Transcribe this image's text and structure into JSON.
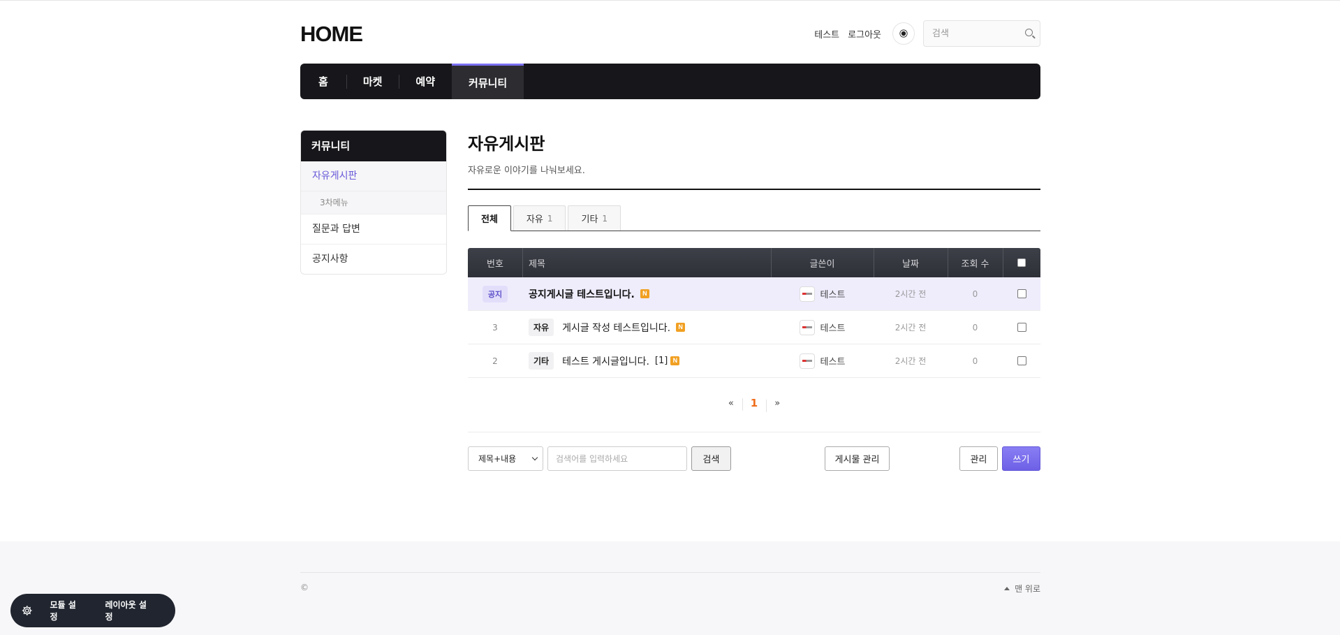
{
  "header": {
    "logo": "HOME",
    "user_name": "테스트",
    "logout": "로그아웃",
    "search_placeholder": "검색"
  },
  "nav": [
    "홈",
    "마켓",
    "예약",
    "커뮤니티"
  ],
  "sidebar": {
    "title": "커뮤니티",
    "items": [
      "자유게시판",
      "3차메뉴",
      "질문과 답변",
      "공지사항"
    ]
  },
  "board": {
    "title": "자유게시판",
    "description": "자유로운 이야기를 나눠보세요.",
    "tabs": [
      {
        "label": "전체",
        "count": ""
      },
      {
        "label": "자유",
        "count": "1"
      },
      {
        "label": "기타",
        "count": "1"
      }
    ],
    "columns": [
      "번호",
      "제목",
      "글쓴이",
      "날짜",
      "조회 수"
    ],
    "rows": [
      {
        "no": "공지",
        "category": "",
        "title": "공지게시글 테스트입니다.",
        "comments": "",
        "new": "N",
        "author": "테스트",
        "date": "2시간 전",
        "views": "0"
      },
      {
        "no": "3",
        "category": "자유",
        "title": "게시글 작성 테스트입니다.",
        "comments": "",
        "new": "N",
        "author": "테스트",
        "date": "2시간 전",
        "views": "0"
      },
      {
        "no": "2",
        "category": "기타",
        "title": "테스트 게시글입니다.",
        "comments": "[1]",
        "new": "N",
        "author": "테스트",
        "date": "2시간 전",
        "views": "0"
      }
    ]
  },
  "pager": {
    "prev": "«",
    "current": "1",
    "next": "»"
  },
  "search": {
    "scope": "제목+내용",
    "placeholder": "검색어를 입력하세요",
    "button": "검색"
  },
  "actions": {
    "manage_posts": "게시물 관리",
    "manage": "관리",
    "write": "쓰기"
  },
  "footer": {
    "copyright": "©",
    "to_top": "맨 위로"
  },
  "float_bar": {
    "module": "모듈 설정",
    "layout": "레이아웃 설정"
  },
  "colors": {
    "accent": "#7a6ff0",
    "nav_bg": "#17171b",
    "new_badge": "#f1a023",
    "current_page": "#ef6c1a"
  }
}
